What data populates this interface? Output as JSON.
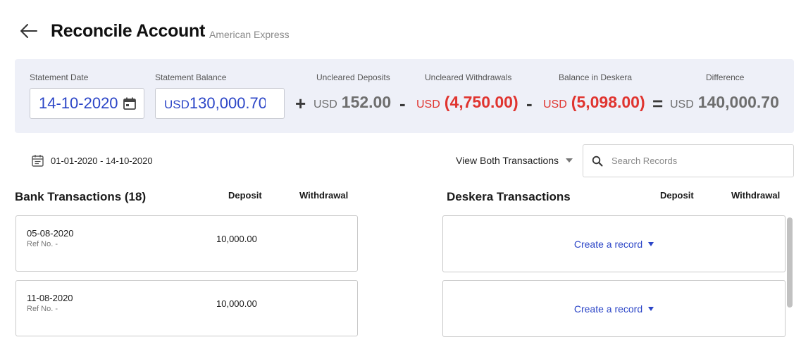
{
  "header": {
    "title": "Reconcile Account",
    "subtitle": "American Express"
  },
  "summary": {
    "statement_date": {
      "label": "Statement Date",
      "value": "14-10-2020"
    },
    "statement_balance": {
      "label": "Statement Balance",
      "currency": "USD",
      "value": "130,000.70"
    },
    "uncleared_deposits": {
      "label": "Uncleared Deposits",
      "currency": "USD",
      "value": "152.00"
    },
    "uncleared_withdrawals": {
      "label": "Uncleared Withdrawals",
      "currency": "USD",
      "value": "(4,750.00)"
    },
    "balance_in_deskera": {
      "label": "Balance in Deskera",
      "currency": "USD",
      "value": "(5,098.00)"
    },
    "difference": {
      "label": "Difference",
      "currency": "USD",
      "value": "140,000.70"
    },
    "operators": {
      "plus": "+",
      "minus1": "-",
      "minus2": "-",
      "equals": "="
    },
    "colors": {
      "accent": "#2b45c7",
      "negative": "#e0342f",
      "panel": "#eef0f8"
    }
  },
  "toolbar": {
    "date_range": "01-01-2020 - 14-10-2020",
    "view_filter": "View Both Transactions",
    "search_placeholder": "Search Records"
  },
  "bank": {
    "title": "Bank Transactions (18)",
    "col_deposit": "Deposit",
    "col_withdrawal": "Withdrawal",
    "rows": [
      {
        "date": "05-08-2020",
        "ref": "Ref No. -",
        "deposit": "10,000.00",
        "withdrawal": ""
      },
      {
        "date": "11-08-2020",
        "ref": "Ref No. -",
        "deposit": "10,000.00",
        "withdrawal": ""
      }
    ]
  },
  "deskera": {
    "title": "Deskera Transactions",
    "col_deposit": "Deposit",
    "col_withdrawal": "Withdrawal",
    "rows": [
      {
        "action": "Create a record"
      },
      {
        "action": "Create a record"
      }
    ]
  }
}
